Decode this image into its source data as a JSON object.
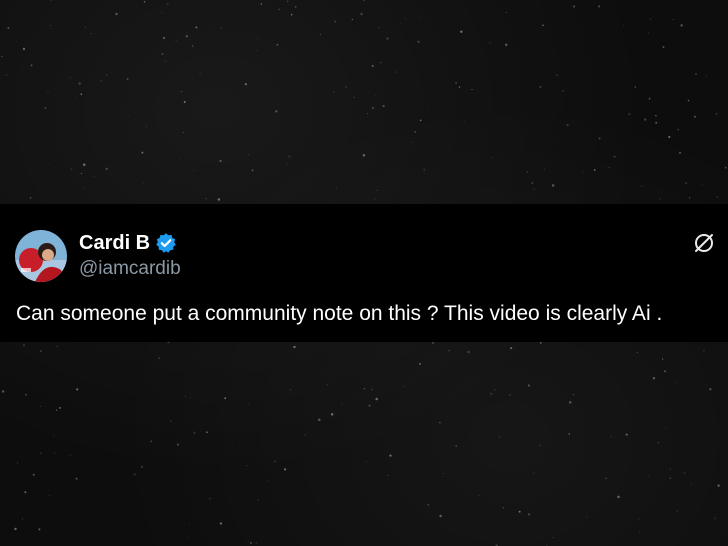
{
  "tweet": {
    "display_name": "Cardi B",
    "handle": "@iamcardib",
    "text": "Can someone put a community note on this ? This video is clearly Ai .",
    "verified": true
  },
  "icons": {
    "verified": "verified-badge-icon",
    "brand": "x-logo-icon"
  },
  "colors": {
    "card_background": "#000000",
    "name": "#ffffff",
    "handle": "#8b98a5",
    "verified": "#1d9bf0",
    "backdrop": "#0d0d0d"
  }
}
